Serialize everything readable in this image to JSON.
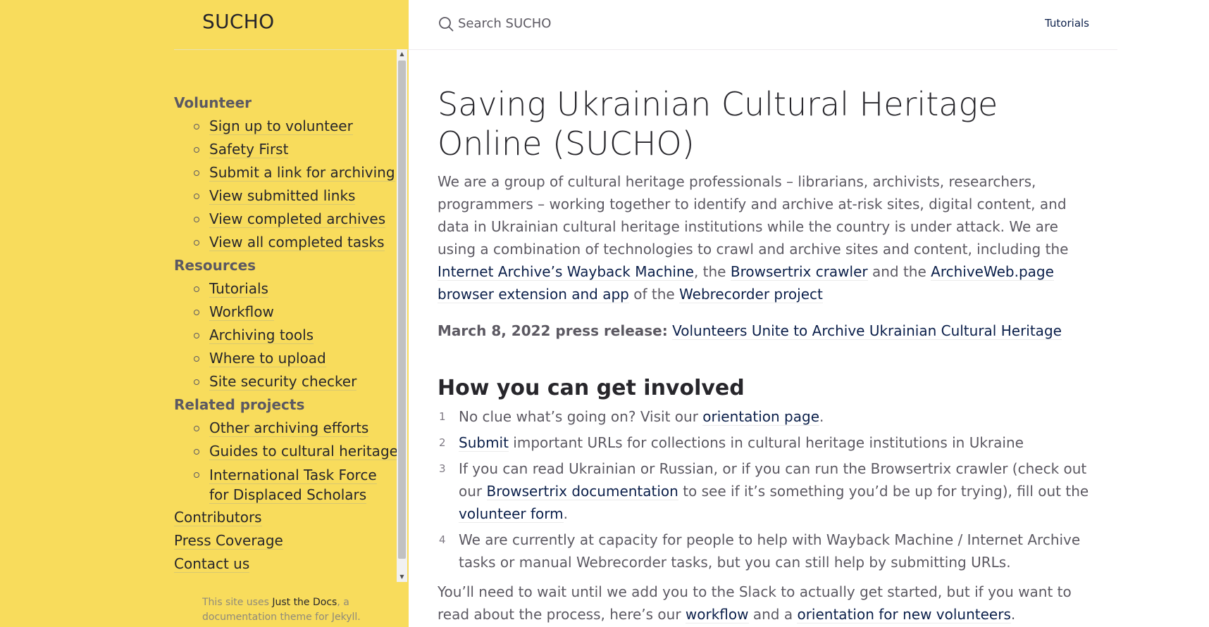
{
  "site": {
    "title": "SUCHO"
  },
  "sidebar": {
    "sections": [
      {
        "title": "Volunteer",
        "items": [
          "Sign up to volunteer",
          "Safety First",
          "Submit a link for archiving",
          "View submitted links",
          "View completed archives",
          "View all completed tasks"
        ]
      },
      {
        "title": "Resources",
        "items": [
          "Tutorials",
          "Workflow",
          "Archiving tools",
          "Where to upload",
          "Site security checker"
        ]
      },
      {
        "title": "Related projects",
        "items": [
          "Other archiving efforts",
          "Guides to cultural heritage",
          "International Task Force for Displaced Scholars"
        ]
      }
    ],
    "top_links": [
      "Contributors",
      "Press Coverage",
      "Contact us"
    ],
    "footer": {
      "prefix": "This site uses ",
      "link": "Just the Docs",
      "suffix": ", a documentation theme for Jekyll."
    }
  },
  "header": {
    "search_placeholder": "Search SUCHO",
    "aux_link": "Tutorials"
  },
  "main": {
    "title": "Saving Ukrainian Cultural Heritage Online (SUCHO)",
    "intro": {
      "text1": "We are a group of cultural heritage professionals – librarians, archivists, researchers, programmers – working together to identify and archive at-risk sites, digital content, and data in Ukrainian cultural heritage institutions while the country is under attack. We are using a combination of technologies to crawl and archive sites and content, including the ",
      "link1": "Internet Archive’s Wayback Machine",
      "text2": ", the ",
      "link2": "Browsertrix crawler",
      "text3": " and the ",
      "link3": "ArchiveWeb.page browser extension and app",
      "text4": " of the ",
      "link4": "Webrecorder project"
    },
    "press": {
      "label": "March 8, 2022 press release:",
      "link": "Volunteers Unite to Archive Ukrainian Cultural Heritage"
    },
    "involved_heading": "How you can get involved",
    "steps": {
      "s1": {
        "num": "1",
        "text1": "No clue what’s going on? Visit our ",
        "link1": "orientation page",
        "text2": "."
      },
      "s2": {
        "num": "2",
        "link1": "Submit",
        "text1": " important URLs for collections in cultural heritage institutions in Ukraine"
      },
      "s3": {
        "num": "3",
        "text1": "If you can read Ukrainian or Russian, or if you can run the Browsertrix crawler (check out our ",
        "link1": "Browsertrix documentation",
        "text2": " to see if it’s something you’d be up for trying), fill out the ",
        "link2": "volunteer form",
        "text3": "."
      },
      "s4": {
        "num": "4",
        "text1": "We are currently at capacity for people to help with Wayback Machine / Internet Archive tasks or manual Webrecorder tasks, but you can still help by submitting URLs."
      }
    },
    "outro": {
      "text1": "You’ll need to wait until we add you to the Slack to actually get started, but if you want to read about the process, here’s our ",
      "link1": "workflow",
      "text2": " and a ",
      "link2": "orientation for new volunteers",
      "text3": "."
    }
  },
  "colors": {
    "sidebar_bg": "#f8dc5c",
    "link": "#0b1f4a",
    "text": "#5c5962",
    "heading": "#27262b"
  },
  "icons": {
    "search": "search-icon",
    "scroll_up": "chevron-up-icon",
    "scroll_down": "chevron-down-icon"
  }
}
